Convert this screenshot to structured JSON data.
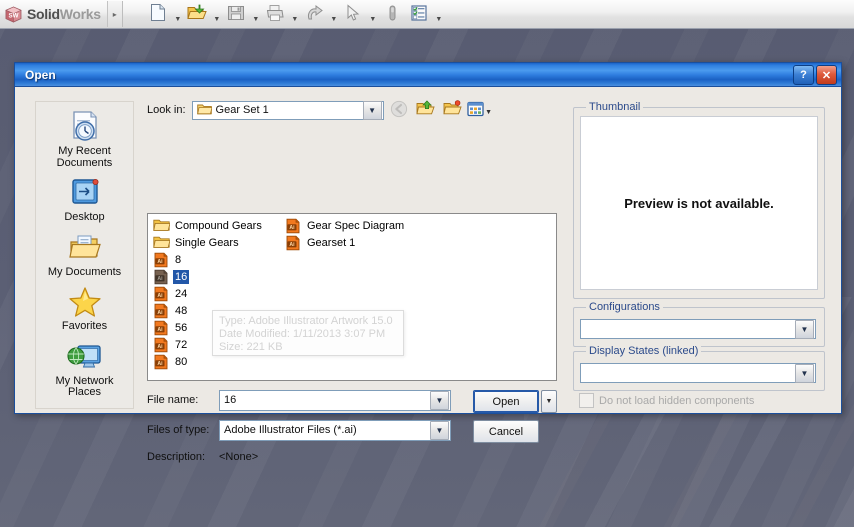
{
  "app": {
    "brand_solid": "Solid",
    "brand_works": "Works",
    "logo_text": "SW",
    "toolbar": [
      {
        "name": "new-document-icon",
        "label": "New",
        "has_arrow": true
      },
      {
        "name": "open-document-icon",
        "label": "Open",
        "has_arrow": true
      },
      {
        "name": "save-icon",
        "label": "Save",
        "has_arrow": true
      },
      {
        "name": "print-icon",
        "label": "Print",
        "has_arrow": true
      },
      {
        "name": "undo-icon",
        "label": "Undo",
        "has_arrow": true
      },
      {
        "name": "select-cursor-icon",
        "label": "Select",
        "has_arrow": true
      },
      {
        "name": "rebuild-icon",
        "label": "Rebuild",
        "has_arrow": false
      },
      {
        "name": "options-icon",
        "label": "Options",
        "has_arrow": true
      }
    ],
    "expand_arrow": "▸"
  },
  "dialog": {
    "title": "Open",
    "help_label": "?",
    "close_label": "✕",
    "lookin": {
      "label": "Look in:",
      "value": "Gear Set 1",
      "dropdown_arrow": "☰",
      "nav_buttons": [
        {
          "name": "back-icon",
          "label": "Back",
          "disabled": true
        },
        {
          "name": "up-one-level-icon",
          "label": "Up One Level",
          "disabled": false
        },
        {
          "name": "new-folder-icon",
          "label": "Create New Folder",
          "disabled": false
        },
        {
          "name": "views-icon",
          "label": "Views",
          "disabled": false
        }
      ]
    },
    "places": [
      {
        "name": "my-recent-documents",
        "label": "My Recent\nDocuments",
        "icon": "recent-documents-icon"
      },
      {
        "name": "desktop",
        "label": "Desktop",
        "icon": "desktop-icon"
      },
      {
        "name": "my-documents",
        "label": "My Documents",
        "icon": "my-documents-icon"
      },
      {
        "name": "favorites",
        "label": "Favorites",
        "icon": "favorites-star-icon"
      },
      {
        "name": "my-network-places",
        "label": "My Network\nPlaces",
        "icon": "network-places-icon"
      }
    ],
    "files": [
      {
        "label": "Compound Gears",
        "kind": "folder",
        "selected": false
      },
      {
        "label": "Single Gears",
        "kind": "folder",
        "selected": false
      },
      {
        "label": "8",
        "kind": "ai",
        "selected": false
      },
      {
        "label": "16",
        "kind": "ai",
        "selected": true
      },
      {
        "label": "24",
        "kind": "ai",
        "selected": false
      },
      {
        "label": "48",
        "kind": "ai",
        "selected": false
      },
      {
        "label": "56",
        "kind": "ai",
        "selected": false
      },
      {
        "label": "72",
        "kind": "ai",
        "selected": false
      },
      {
        "label": "80",
        "kind": "ai",
        "selected": false
      },
      {
        "label": "Gear Spec Diagram",
        "kind": "ai",
        "selected": false
      },
      {
        "label": "Gearset 1",
        "kind": "ai",
        "selected": false
      }
    ],
    "file_icon_text": "Ai",
    "tooltip": {
      "type": "Type: Adobe Illustrator Artwork 15.0",
      "date": "Date Modified: 1/11/2013 3:07 PM",
      "size": "Size: 221 KB"
    },
    "filename": {
      "label": "File name:",
      "value": "16"
    },
    "filetype": {
      "label": "Files of type:",
      "value": "Adobe Illustrator Files (*.ai)"
    },
    "description": {
      "label": "Description:",
      "value": "<None>"
    },
    "open_button": "Open",
    "open_split_arrow": "▼",
    "cancel_button": "Cancel",
    "thumbnail": {
      "title": "Thumbnail",
      "text": "Preview is not available."
    },
    "configurations": {
      "title": "Configurations",
      "value": ""
    },
    "display_states": {
      "title": "Display States (linked)",
      "value": ""
    },
    "hidden_components": {
      "label": "Do not load hidden components",
      "checked": false
    }
  },
  "colors": {
    "title_blue": "#2f7ddf",
    "selection_blue": "#2257a8",
    "group_label_blue": "#2b4a8b",
    "dialog_face": "#ece9e4",
    "desktop": "#5a5e73"
  }
}
